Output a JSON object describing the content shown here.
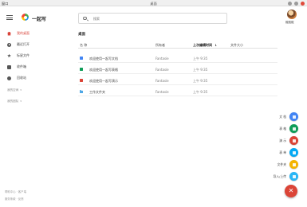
{
  "window": {
    "menu_label": "窗口",
    "title": "桌面"
  },
  "header": {
    "app_name": "一起写",
    "search_placeholder": "搜索",
    "username": "敲敲敲"
  },
  "sidebar": {
    "items": [
      {
        "label": "我的桌面",
        "icon": "home-icon",
        "active": true
      },
      {
        "label": "最近打开",
        "icon": "clock-icon"
      },
      {
        "label": "标星文件",
        "icon": "star-icon"
      },
      {
        "label": "收件箱",
        "icon": "mail-icon"
      },
      {
        "label": "回收站",
        "icon": "trash-icon"
      }
    ],
    "sections": [
      {
        "label": "我的空间"
      },
      {
        "label": "我的团队"
      }
    ],
    "footer": {
      "line1": "帮助中心 · 客户端",
      "line2": "服务条款 · 反馈"
    }
  },
  "main": {
    "breadcrumb": "桌面",
    "columns": {
      "name": "名 称",
      "owner": "所有者",
      "modified": "上次编辑时间",
      "size": "文件大小"
    },
    "rows": [
      {
        "type": "doc",
        "name": "欢迎使用一起写文档",
        "owner": "Fantasie",
        "modified": "上午 9:35",
        "size": ""
      },
      {
        "type": "sheet",
        "name": "欢迎使用一起写表格",
        "owner": "Fantasie",
        "modified": "上午 9:35",
        "size": ""
      },
      {
        "type": "slide",
        "name": "欢迎使用一起写演示",
        "owner": "Fantasie",
        "modified": "上午 9:35",
        "size": ""
      },
      {
        "type": "folder",
        "name": "工作文件夹",
        "owner": "Fantasie",
        "modified": "上午 9:35",
        "size": ""
      }
    ]
  },
  "fab_menu": {
    "items": [
      {
        "label": "文 档",
        "color": "#4285f4"
      },
      {
        "label": "表 格",
        "color": "#0f9d58"
      },
      {
        "label": "演 示",
        "color": "#db4437"
      },
      {
        "label": "表 单",
        "color": "#03a9f4"
      },
      {
        "label": "文件夹",
        "color": "#f4b400"
      },
      {
        "label": "导入/上传",
        "color": "#29b6f6"
      }
    ],
    "main_icon": "close-icon",
    "main_symbol": "✕"
  }
}
